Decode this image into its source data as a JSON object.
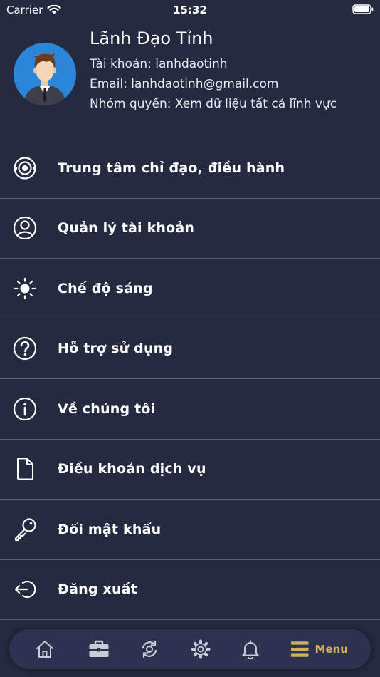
{
  "status_bar": {
    "carrier": "Carrier",
    "time": "15:32"
  },
  "profile": {
    "name": "Lãnh Đạo Tỉnh",
    "account": "Tài khoản: lanhdaotinh",
    "email": "Email: lanhdaotinh@gmail.com",
    "group": "Nhóm quyền: Xem dữ liệu tất cả lĩnh vực"
  },
  "menu": {
    "items": [
      {
        "label": "Trung tâm chỉ đạo, điều hành",
        "icon": "target-icon"
      },
      {
        "label": "Quản lý tài khoản",
        "icon": "user-circle-icon"
      },
      {
        "label": "Chế độ sáng",
        "icon": "sun-icon"
      },
      {
        "label": "Hỗ trợ sử dụng",
        "icon": "help-circle-icon"
      },
      {
        "label": "Về chúng tôi",
        "icon": "info-circle-icon"
      },
      {
        "label": "Điều khoản dịch vụ",
        "icon": "document-icon"
      },
      {
        "label": "Đổi mật khẩu",
        "icon": "key-icon"
      },
      {
        "label": "Đăng xuất",
        "icon": "logout-icon"
      }
    ]
  },
  "tabbar": {
    "items": [
      {
        "icon": "home-icon"
      },
      {
        "icon": "briefcase-icon"
      },
      {
        "icon": "sync-icon"
      },
      {
        "icon": "gear-icon"
      },
      {
        "icon": "bell-icon"
      },
      {
        "icon": "menu-icon",
        "label": "Menu",
        "active": true
      }
    ],
    "active_color": "#d4ad62",
    "inactive_color": "#c9cbd6"
  },
  "colors": {
    "background": "#262a40",
    "divider": "#5b5f73",
    "tabbar": "#2d3250"
  }
}
